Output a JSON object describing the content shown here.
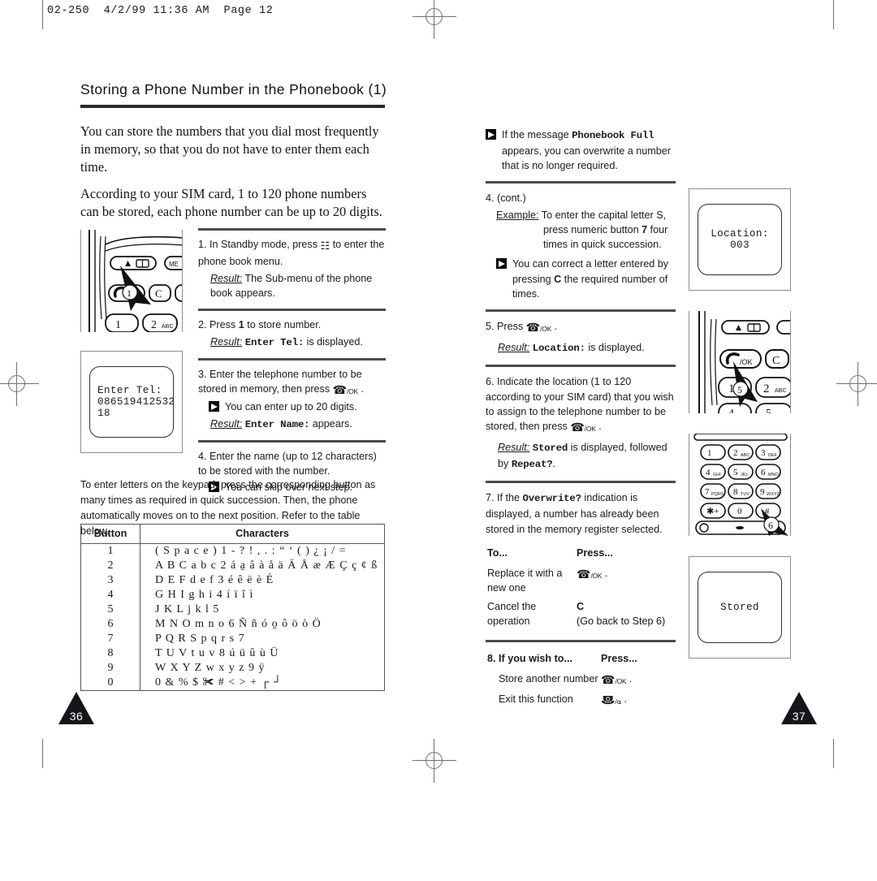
{
  "slug": "02-250  4/2/99 11:36 AM  Page 12",
  "title": "Storing a Phone Number in the Phonebook (1)",
  "intro": [
    "You can store the numbers that you dial most frequently in memory, so that you do not have to enter them each time.",
    "According to your SIM card, 1 to 120 phone numbers can be stored, each phone number can be up to 20 digits."
  ],
  "steps_left": [
    {
      "num": "1.",
      "text_before": "In Standby mode, press",
      "icon": "phonebook-key-icon",
      "text_after": "to enter the phone book menu.",
      "result_label": "Result:",
      "result_text": "The Sub-menu of the phone book appears."
    },
    {
      "num": "2.",
      "text_before": "Press",
      "bold": "1",
      "text_after": "to store number.",
      "result_label": "Result:",
      "result_mono": "Enter Tel:",
      "result_tail": "is displayed."
    },
    {
      "num": "3.",
      "text_before": "Enter the telephone number to be stored in memory, then press",
      "icon": "send-ok-key-icon",
      "text_after": ".",
      "note": "You can enter up to 20 digits.",
      "result_label": "Result:",
      "result_mono": "Enter Name:",
      "result_tail": "appears."
    },
    {
      "num": "4.",
      "text_before": "Enter the name (up to 12 characters) to be stored with the number.",
      "note": "You can skip over next step."
    }
  ],
  "table_intro": "To enter letters on the keypad, press the corresponding button as many times as required in quick succession. Then, the phone automatically moves on to the next position. Refer to the table below.",
  "char_table": {
    "headers": [
      "Button",
      "Characters"
    ],
    "rows": [
      [
        "1",
        "( S p a c e ) 1 - ? ! , . : “ ‘ ( ) ¿ ¡ / ="
      ],
      [
        "2",
        "A B C a b c 2 á a̱ â à å ä Ä Å æ Æ Ç ç ¢ ß"
      ],
      [
        "3",
        "D E F d e f 3 é ê ë è É"
      ],
      [
        "4",
        "G H I g h i 4 í ï î ì"
      ],
      [
        "5",
        "J K L j k l 5"
      ],
      [
        "6",
        "M N O m n o 6 Ñ ñ ó o̱ ô ö ò Ö"
      ],
      [
        "7",
        "P Q R S p q r s 7"
      ],
      [
        "8",
        "T U V t u v 8 ú ü û ù Ü"
      ],
      [
        "9",
        "W X Y Z w x y z 9 ÿ"
      ],
      [
        "0",
        "0 & % $ ✀ # < > + ┌ ┘"
      ]
    ]
  },
  "right": {
    "top_note": {
      "before": "If the message",
      "mono": "Phonebook Full",
      "after": "appears, you can overwrite a number that is no longer required."
    },
    "step4_cont": {
      "num": "4.",
      "label": "(cont.)",
      "example_label": "Example:",
      "example_line1": "To enter the capital letter S,",
      "example_line2": "press numeric button",
      "example_bold": "7",
      "example_line2b": "four",
      "example_line3": "times in quick succession.",
      "note_before": "You can correct a letter entered by pressing",
      "note_bold": "C",
      "note_after": "the required number of times."
    },
    "step5": {
      "num": "5.",
      "text": "Press",
      "icon": "send-ok-key-icon",
      "result_label": "Result:",
      "result_mono": "Location:",
      "result_tail": "is displayed."
    },
    "step6": {
      "num": "6.",
      "text": "Indicate the location (1 to 120 according to your SIM card) that you wish to assign to the telephone number to be stored, then press",
      "icon": "send-ok-key-icon",
      "result_label": "Result:",
      "result_mono": "Stored",
      "result_mid": "is displayed, followed by",
      "result_mono2": "Repeat?",
      "result_tail": "."
    },
    "step7": {
      "num": "7.",
      "text_before": "If the",
      "bold": "Overwrite?",
      "text_after": "indication is displayed, a number has already been stored in the memory register selected.",
      "table_headers": [
        "To...",
        "Press..."
      ],
      "rows": [
        {
          "to": "Replace it with a new one",
          "press_icon": "send-ok-key-icon",
          "press_text": "."
        },
        {
          "to": "Cancel the operation",
          "press_bold": "C",
          "press_text": "(Go back to Step 6)"
        }
      ]
    },
    "step8": {
      "num": "8.",
      "header_left": "If you wish to...",
      "header_right": "Press...",
      "rows": [
        {
          "to": "Store another number",
          "press_icon": "send-ok-key-icon",
          "press_text": "."
        },
        {
          "to": "Exit this function",
          "press_icon": "end-call-key-icon",
          "press_text": "."
        }
      ]
    }
  },
  "lcd_screens": {
    "enter_tel": {
      "line1": "Enter Tel:",
      "line2": "086519412532",
      "line3": "18"
    },
    "location": {
      "line1": "Location:",
      "line2": "003"
    },
    "stored": {
      "line1": "Stored"
    }
  },
  "illustrations": [
    {
      "name": "phone-keypad-phonebook-key",
      "marker": "1"
    },
    {
      "name": "phone-keypad-send-key",
      "marker": "5"
    },
    {
      "name": "phone-full-keypad",
      "marker": "6"
    }
  ],
  "page_numbers": {
    "left": "36",
    "right": "37"
  }
}
